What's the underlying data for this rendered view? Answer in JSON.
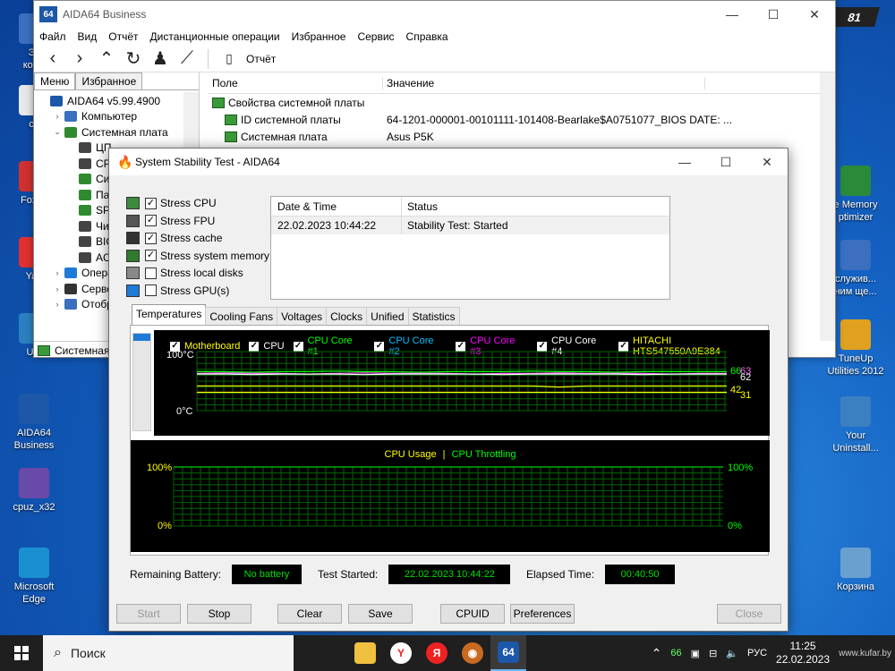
{
  "desktop": {
    "left_icons": [
      {
        "label": "Эт\nкомп",
        "top": 15
      },
      {
        "label": "ср",
        "top": 95
      },
      {
        "label": "Foxit I",
        "top": 180
      },
      {
        "label": "Yan",
        "top": 265
      },
      {
        "label": "Ultr",
        "top": 350
      },
      {
        "label": "AIDA64\nBusiness",
        "top": 440
      },
      {
        "label": "cpuz_x32",
        "top": 523
      },
      {
        "label": "Microsoft\nEdge",
        "top": 612
      }
    ],
    "right_icons": [
      {
        "label": "e Memory\nptimizer",
        "top": 185
      },
      {
        "label": "служив...\nним ще...",
        "top": 268
      },
      {
        "label": "TuneUp\nUtilities 2012",
        "top": 357
      },
      {
        "label": "Your\nUninstall...",
        "top": 443
      },
      {
        "label": "Корзина",
        "top": 612
      }
    ],
    "corner_badge": "81"
  },
  "mainwin": {
    "title": "AIDA64 Business",
    "logo": "64",
    "menu": [
      "Файл",
      "Вид",
      "Отчёт",
      "Дистанционные операции",
      "Избранное",
      "Сервис",
      "Справка"
    ],
    "toolbar_report": "Отчёт",
    "tabs": [
      "Меню",
      "Избранное"
    ],
    "tree": [
      {
        "label": "AIDA64 v5.99.4900",
        "indent": 0,
        "toggle": "",
        "color": "#1c57a8"
      },
      {
        "label": "Компьютер",
        "indent": 1,
        "toggle": "›",
        "color": "#3b6fc0"
      },
      {
        "label": "Системная плата",
        "indent": 1,
        "toggle": "⌄",
        "color": "#2f8a2f"
      },
      {
        "label": "ЦП",
        "indent": 2,
        "toggle": "",
        "color": "#444"
      },
      {
        "label": "CPU",
        "indent": 2,
        "toggle": "",
        "color": "#444"
      },
      {
        "label": "Сис",
        "indent": 2,
        "toggle": "",
        "color": "#2f8a2f"
      },
      {
        "label": "Пам",
        "indent": 2,
        "toggle": "",
        "color": "#2f8a2f"
      },
      {
        "label": "SPD",
        "indent": 2,
        "toggle": "",
        "color": "#2f8a2f"
      },
      {
        "label": "Чип",
        "indent": 2,
        "toggle": "",
        "color": "#444"
      },
      {
        "label": "BIOS",
        "indent": 2,
        "toggle": "",
        "color": "#444"
      },
      {
        "label": "ACP",
        "indent": 2,
        "toggle": "",
        "color": "#444"
      },
      {
        "label": "Операц",
        "indent": 1,
        "toggle": "›",
        "color": "#1e7ad6"
      },
      {
        "label": "Сервер",
        "indent": 1,
        "toggle": "›",
        "color": "#333"
      },
      {
        "label": "Отобра",
        "indent": 1,
        "toggle": "›",
        "color": "#3b6fc0"
      }
    ],
    "status": "Системная",
    "columns": [
      "Поле",
      "Значение"
    ],
    "rows": [
      {
        "field": "Свойства системной платы",
        "value": "",
        "indent": 0
      },
      {
        "field": "ID системной платы",
        "value": "64-1201-000001-00101111-101408-Bearlake$A0751077_BIOS DATE: ...",
        "indent": 1
      },
      {
        "field": "Системная плата",
        "value": "Asus P5K",
        "indent": 1
      }
    ]
  },
  "sst": {
    "title": "System Stability Test - AIDA64",
    "checks": [
      {
        "label": "Stress CPU",
        "checked": "✓",
        "color": "#3c8a3c"
      },
      {
        "label": "Stress FPU",
        "checked": "✓",
        "color": "#555"
      },
      {
        "label": "Stress cache",
        "checked": "✓",
        "color": "#333"
      },
      {
        "label": "Stress system memory",
        "checked": "✓",
        "color": "#2f7a2f"
      },
      {
        "label": "Stress local disks",
        "checked": "",
        "color": "#888"
      },
      {
        "label": "Stress GPU(s)",
        "checked": "",
        "color": "#1e7ad6"
      }
    ],
    "log_headers": [
      "Date & Time",
      "Status"
    ],
    "log_rows": [
      {
        "time": "22.02.2023 10:44:22",
        "status": "Stability Test: Started"
      }
    ],
    "tabs": [
      "Temperatures",
      "Cooling Fans",
      "Voltages",
      "Clocks",
      "Unified",
      "Statistics"
    ],
    "legend": [
      {
        "label": "Motherboard",
        "color": "#ffff00"
      },
      {
        "label": "CPU",
        "color": "#ffffff"
      },
      {
        "label": "CPU Core #1",
        "color": "#00ff00"
      },
      {
        "label": "CPU Core #2",
        "color": "#00c0ff"
      },
      {
        "label": "CPU Core #3",
        "color": "#ff00ff"
      },
      {
        "label": "CPU Core #4",
        "color": "#ffffff"
      },
      {
        "label": "HITACHI HTS547550A9E384",
        "color": "#ffff00"
      }
    ],
    "temp_ymax": "100°C",
    "temp_ymin": "0°C",
    "temp_values": [
      {
        "v": "66",
        "color": "#00ff00"
      },
      {
        "v": "63",
        "color": "#ff66ff"
      },
      {
        "v": "62",
        "color": "#ffffff"
      },
      {
        "v": "42",
        "color": "#ffff00"
      },
      {
        "v": "31",
        "color": "#ffff00"
      }
    ],
    "cpu_title1": "CPU Usage",
    "cpu_sep": "|",
    "cpu_title2": "CPU Throttling",
    "cpu_ymax": "100%",
    "cpu_ymin": "0%",
    "cpu_ymax_r": "100%",
    "cpu_ymin_r": "0%",
    "remaining_label": "Remaining Battery:",
    "remaining_value": "No battery",
    "started_label": "Test Started:",
    "started_value": "22.02.2023 10:44:22",
    "elapsed_label": "Elapsed Time:",
    "elapsed_value": "00:40:50",
    "buttons": {
      "start": "Start",
      "stop": "Stop",
      "clear": "Clear",
      "save": "Save",
      "cpuid": "CPUID",
      "preferences": "Preferences",
      "close": "Close"
    }
  },
  "chart_data": {
    "type": "line",
    "ylim": [
      0,
      100
    ],
    "series": [
      {
        "name": "CPU Core #1",
        "values": [
          66,
          66,
          65,
          66,
          66,
          67,
          66,
          66,
          65,
          66,
          66,
          66,
          67,
          66,
          66,
          65,
          66,
          66,
          66,
          66
        ]
      },
      {
        "name": "CPU Core #3",
        "values": [
          63,
          64,
          63,
          63,
          62,
          63,
          64,
          63,
          63,
          63,
          62,
          63,
          63,
          64,
          63,
          63,
          63,
          62,
          63,
          63
        ]
      },
      {
        "name": "CPU Core #4",
        "values": [
          62,
          62,
          61,
          62,
          62,
          62,
          61,
          62,
          62,
          62,
          62,
          61,
          62,
          62,
          62,
          62,
          61,
          62,
          62,
          62
        ]
      },
      {
        "name": "Motherboard",
        "values": [
          42,
          42,
          42,
          42,
          42,
          42,
          42,
          42,
          42,
          42,
          42,
          42,
          42,
          40,
          42,
          42,
          42,
          42,
          42,
          42
        ]
      },
      {
        "name": "HITACHI HTS547550A9E384",
        "values": [
          31,
          31,
          31,
          31,
          31,
          31,
          31,
          31,
          31,
          31,
          31,
          31,
          31,
          31,
          31,
          31,
          31,
          31,
          31,
          31
        ]
      }
    ]
  },
  "taskbar": {
    "search": "Поиск",
    "temp": "66",
    "lang": "РУС",
    "time": "11:25",
    "date": "22.02.2023",
    "watermark": "www.kufar.by"
  }
}
